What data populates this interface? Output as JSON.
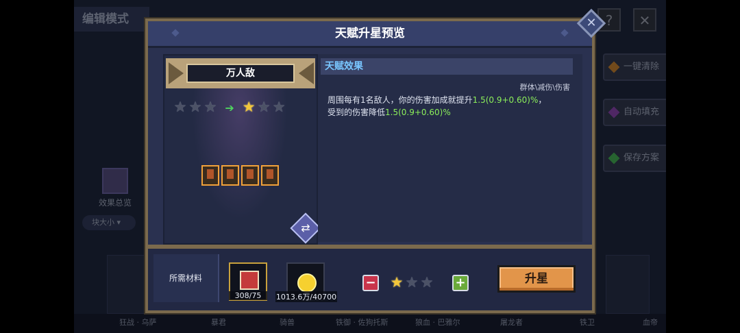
{
  "background": {
    "mode_title": "编辑模式",
    "help_icon": "?",
    "close_icon": "✕",
    "side_buttons": [
      "一键清除",
      "自动填充",
      "保存方案"
    ],
    "effect_overview": "效果总览",
    "size_filter": "块大小",
    "bottom_names": [
      "狂战 · 乌萨",
      "暴君",
      "骑兽",
      "铁御 · 佐狗托斯",
      "狼血 · 巴雅尔",
      "屠龙者",
      "铁卫",
      "血帝"
    ]
  },
  "dialog": {
    "title": "天赋升星预览",
    "close_icon": "close-icon",
    "talent_name": "万人敌",
    "stars_before": [
      false,
      false,
      false
    ],
    "stars_after": [
      true,
      false,
      false
    ],
    "arrow": "➔",
    "minion_count": 4,
    "effect": {
      "header": "天赋效果",
      "tags": "群体\\减伤\\伤害",
      "line1_a": "周围每有1名敌人，你的伤害加成就提升",
      "line1_b": "1.5(0.9+0.60)%",
      "line1_c": "，",
      "line2_a": "受到的伤害降低",
      "line2_b": "1.5(0.9+0.60)%"
    },
    "materials_label": "所需材料",
    "materials": [
      {
        "count": "308/75"
      },
      {
        "count": "1013.6万/40700"
      }
    ],
    "minus": "−",
    "plus": "+",
    "target_stars": [
      true,
      false,
      false
    ],
    "upgrade_button": "升星"
  },
  "colors": {
    "accent_green": "#8cf05a",
    "header_blue": "#79c6ff",
    "button_orange": "#e2954a",
    "star_gold": "#f3c63a"
  }
}
